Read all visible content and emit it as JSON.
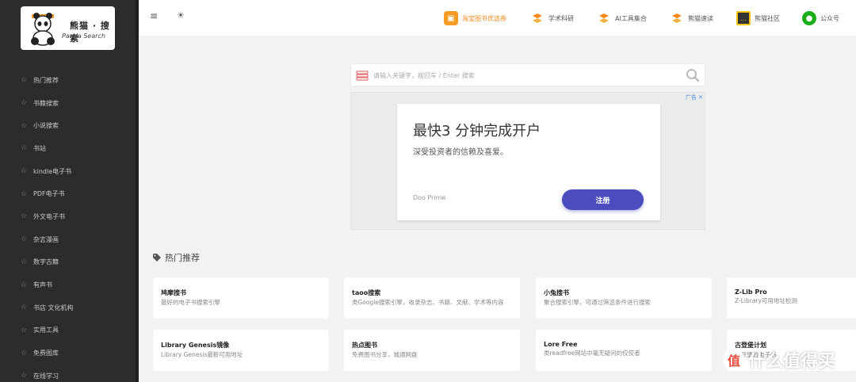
{
  "logo": {
    "title_cn": "熊猫 · 搜索",
    "title_en": "Panda Search"
  },
  "sidebar": {
    "items": [
      {
        "label": "热门推荐"
      },
      {
        "label": "书籍搜索"
      },
      {
        "label": "小说搜索"
      },
      {
        "label": "书站"
      },
      {
        "label": "kindle电子书"
      },
      {
        "label": "PDF电子书"
      },
      {
        "label": "外文电子书"
      },
      {
        "label": "杂志漫画"
      },
      {
        "label": "数字古籍"
      },
      {
        "label": "有声书"
      },
      {
        "label": "书店 文化机构"
      },
      {
        "label": "实用工具"
      },
      {
        "label": "免费图库"
      },
      {
        "label": "在线学习"
      }
    ]
  },
  "topbar": {
    "links": [
      {
        "label": "淘宝图书优选券",
        "icon": "taobao-icon"
      },
      {
        "label": "学术科研",
        "icon": "tools-icon"
      },
      {
        "label": "AI工具集合",
        "icon": "tools-icon"
      },
      {
        "label": "熊猫速读",
        "icon": "tools-icon"
      },
      {
        "label": "熊猫社区",
        "icon": "community-icon"
      },
      {
        "label": "公众号",
        "icon": "wechat-icon"
      }
    ]
  },
  "search": {
    "placeholder": "请输入关键字，按回车 / Enter 搜索"
  },
  "ad": {
    "tag": "广告 ✕",
    "title": "最快3 分钟完成开户",
    "subtitle": "深受投资者的信赖及喜爱。",
    "brand": "Doo Prime",
    "button": "注册"
  },
  "section": {
    "title": "热门推荐"
  },
  "cards": [
    {
      "title": "鸠摩搜书",
      "desc": "最好的电子书搜索引擎"
    },
    {
      "title": "taoo搜索",
      "desc": "类Google搜索引擎，收录杂志、书籍、文献、学术等内容"
    },
    {
      "title": "小兔搜书",
      "desc": "聚合搜索引擎，可通过筛选条件进行搜索"
    },
    {
      "title": "Z-Lib Pro",
      "desc": "Z-Library可用地址检测"
    },
    {
      "title": "Library Genesis镜像",
      "desc": "Library Genesis最新可用地址"
    },
    {
      "title": "热点图书",
      "desc": "免费图书分享，城通网盘"
    },
    {
      "title": "Lore Free",
      "desc": "类readfree网站中毫无疑问的佼佼者"
    },
    {
      "title": "古登堡计划",
      "desc": "古登堡的电子书"
    }
  ],
  "watermark": {
    "text": "什么值得买",
    "badge": "值"
  },
  "colors": {
    "sidebar": "#2b2c2e",
    "accent": "#f58a1f",
    "ad_button": "#4b4dbf",
    "wechat": "#1aad19"
  }
}
